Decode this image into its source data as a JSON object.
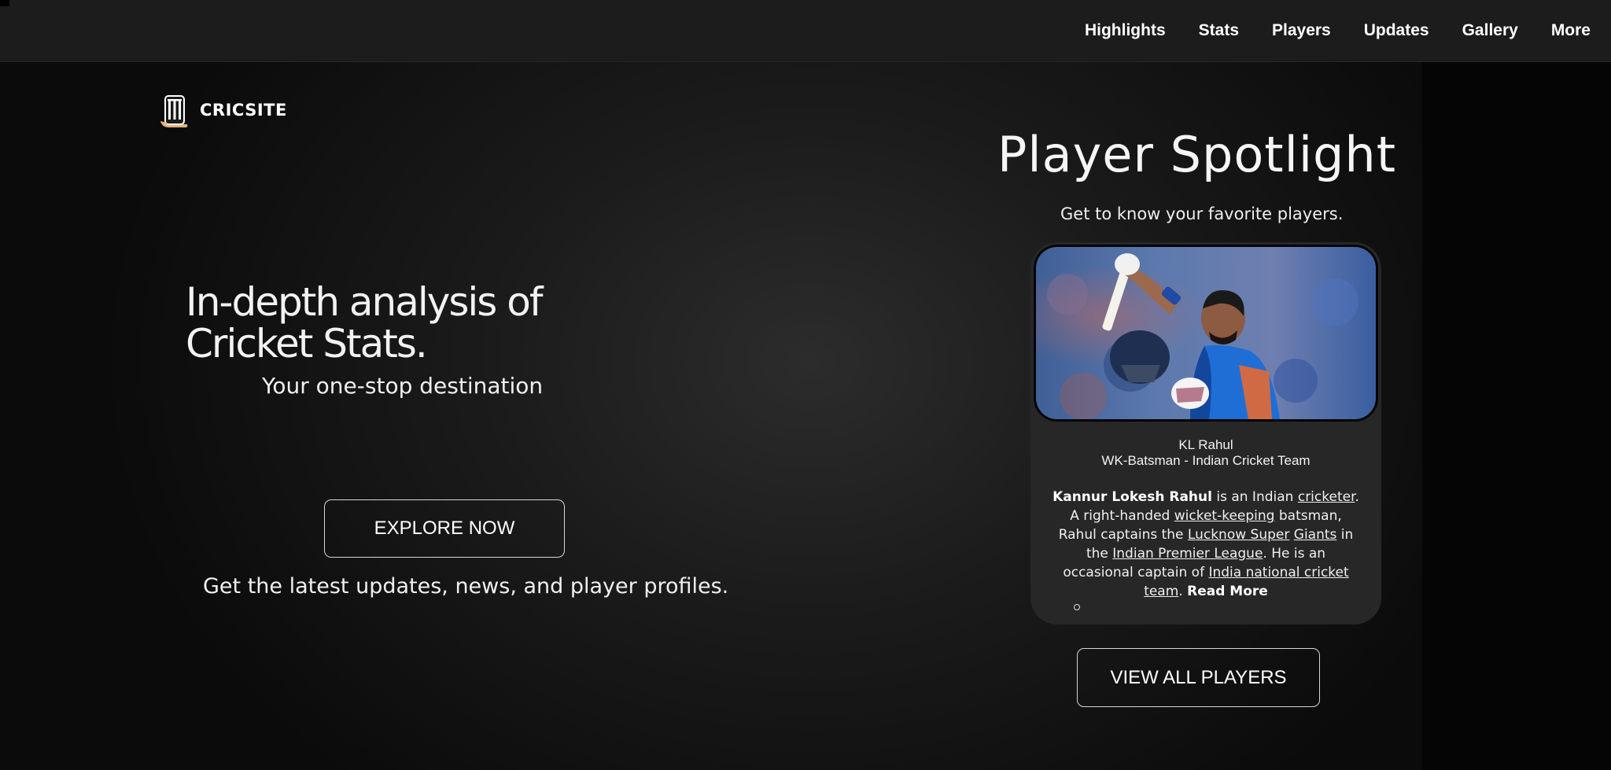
{
  "nav": {
    "items": [
      {
        "label": "Highlights"
      },
      {
        "label": "Stats"
      },
      {
        "label": "Players"
      },
      {
        "label": "Updates"
      },
      {
        "label": "Gallery"
      },
      {
        "label": "More"
      }
    ]
  },
  "logo": {
    "text": "CRICSITE",
    "icon": "cricket-stumps-icon"
  },
  "hero": {
    "title_line1": "In-depth analysis of",
    "title_line2": "Cricket Stats.",
    "subtitle": "Your one-stop destination",
    "cta_label": "EXPLORE NOW",
    "description": "Get the latest updates, news, and player profiles."
  },
  "spotlight": {
    "title": "Player Spotlight",
    "subtitle": "Get to know your favorite players.",
    "player": {
      "photo": "player-photo",
      "name": "KL Rahul",
      "role": "WK-Batsman - Indian Cricket Team",
      "bio": {
        "full_name": "Kannur Lokesh Rahul",
        "t1": " is an Indian ",
        "link_cricketer": "cricketer",
        "t2": ". A right-handed ",
        "link_wk": "wicket-keeping",
        "t3": " batsman, Rahul captains the ",
        "link_lsg_a": "Lucknow Super",
        "t4": " ",
        "link_lsg_b": "Giants",
        "t5": " in the ",
        "link_ipl": "Indian Premier League",
        "t6": ". He is an occasional captain of ",
        "link_team": "India national cricket team",
        "t7": ". ",
        "read_more": "Read More"
      }
    },
    "cta_label": "VIEW ALL PLAYERS"
  },
  "colors": {
    "background": "#1b1b1b",
    "navbar": "#1c1c1c",
    "card": "#272727",
    "accent_logo": "#e8b07a"
  }
}
